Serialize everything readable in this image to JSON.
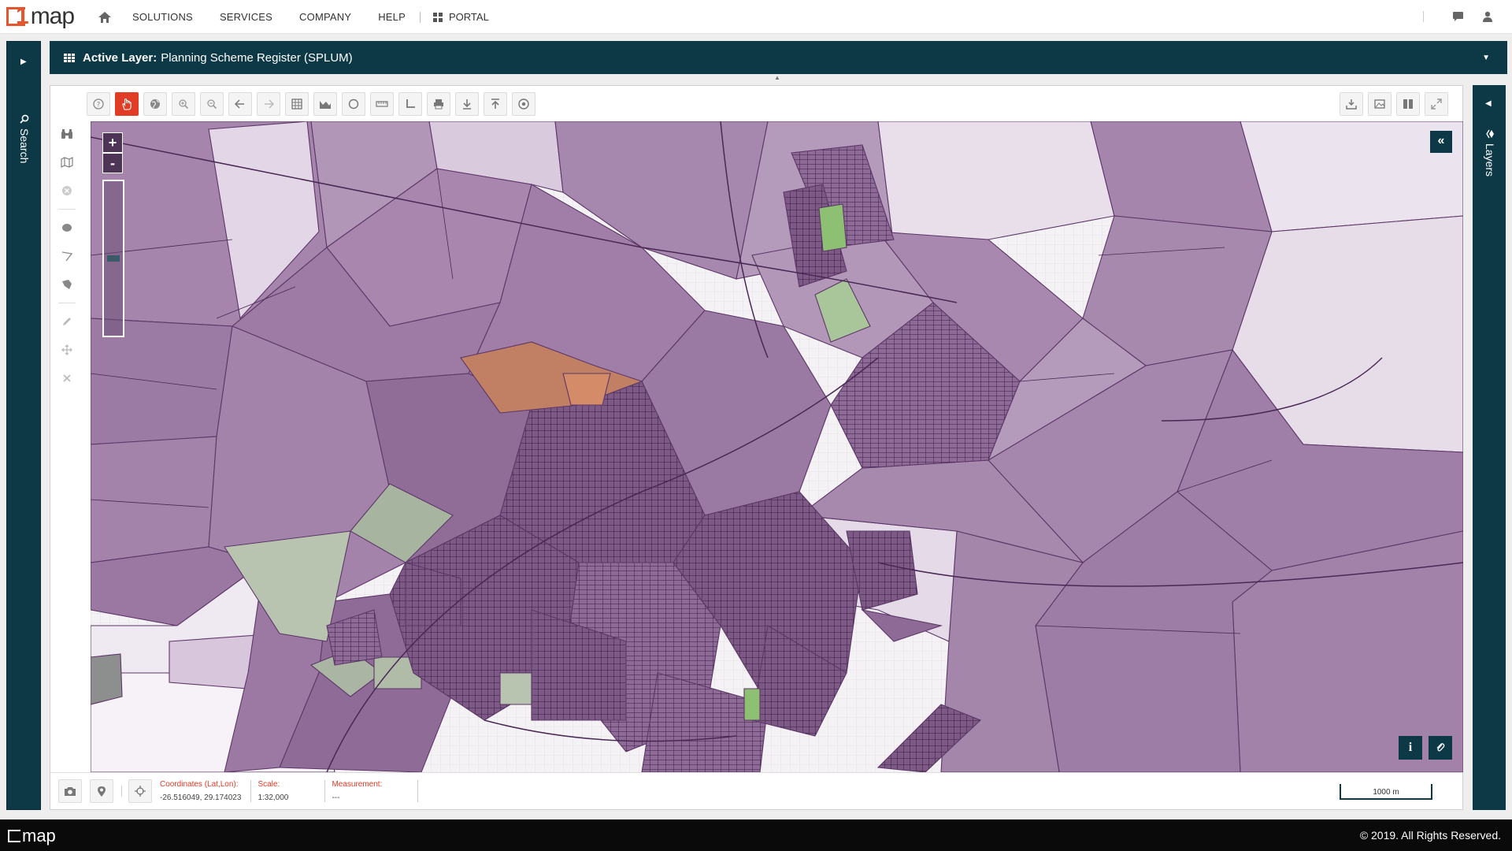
{
  "brand": {
    "logo_digit": "1",
    "logo_text": "map"
  },
  "nav": {
    "items": [
      "SOLUTIONS",
      "SERVICES",
      "COMPANY",
      "HELP"
    ],
    "portal_label": "PORTAL"
  },
  "search_panel": {
    "label": "Search"
  },
  "layers_panel": {
    "label": "Layers"
  },
  "active_layer": {
    "key": "Active Layer:",
    "value": "Planning Scheme Register (SPLUM)"
  },
  "map": {
    "zoom_in": "+",
    "zoom_out": "-",
    "collapse_label": "«",
    "info_label": "i"
  },
  "status": {
    "coords_label": "Coordinates (Lat,Lon):",
    "coords_value": "-26.516049, 29.174023",
    "scale_label": "Scale:",
    "scale_value": "1:32,000",
    "measurement_label": "Measurement:",
    "measurement_value": "---",
    "scalebar_text": "1000 m"
  },
  "footer": {
    "copyright": "© 2019. All Rights Reserved."
  },
  "colors": {
    "accent": "#e03c26",
    "panel": "#0d3947",
    "parcel": "#a17fa8",
    "parcel_dark": "#4e2a5c",
    "green_zone": "#8bc17a"
  }
}
